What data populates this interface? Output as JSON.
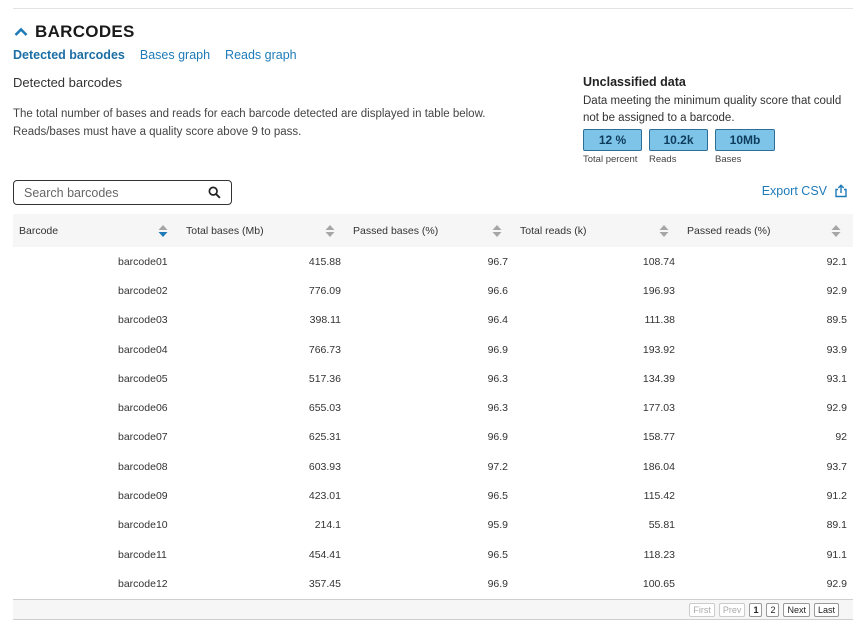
{
  "section": {
    "title": "BARCODES"
  },
  "tabs": [
    {
      "label": "Detected barcodes",
      "active": true
    },
    {
      "label": "Bases graph",
      "active": false
    },
    {
      "label": "Reads graph",
      "active": false
    }
  ],
  "main": {
    "subtitle": "Detected barcodes",
    "desc_line1": "The total number of bases and reads for each barcode detected are displayed in table below.",
    "desc_line2": "Reads/bases must have a quality score above 9 to pass."
  },
  "unclassified": {
    "title": "Unclassified data",
    "desc_line1": "Data meeting the minimum quality score that could",
    "desc_line2": "not be assigned to a barcode.",
    "stats": [
      {
        "value": "12 %",
        "label": "Total percent"
      },
      {
        "value": "10.2k",
        "label": "Reads"
      },
      {
        "value": "10Mb",
        "label": "Bases"
      }
    ]
  },
  "search": {
    "placeholder": "Search barcodes"
  },
  "export": {
    "label": "Export CSV"
  },
  "table": {
    "headers": [
      "Barcode",
      "Total bases (Mb)",
      "Passed bases (%)",
      "Total reads (k)",
      "Passed reads (%)"
    ],
    "sorted_column": 0,
    "sort_direction": "desc",
    "rows": [
      [
        "barcode01",
        "415.88",
        "96.7",
        "108.74",
        "92.1"
      ],
      [
        "barcode02",
        "776.09",
        "96.6",
        "196.93",
        "92.9"
      ],
      [
        "barcode03",
        "398.11",
        "96.4",
        "111.38",
        "89.5"
      ],
      [
        "barcode04",
        "766.73",
        "96.9",
        "193.92",
        "93.9"
      ],
      [
        "barcode05",
        "517.36",
        "96.3",
        "134.39",
        "93.1"
      ],
      [
        "barcode06",
        "655.03",
        "96.3",
        "177.03",
        "92.9"
      ],
      [
        "barcode07",
        "625.31",
        "96.9",
        "158.77",
        "92"
      ],
      [
        "barcode08",
        "603.93",
        "97.2",
        "186.04",
        "93.7"
      ],
      [
        "barcode09",
        "423.01",
        "96.5",
        "115.42",
        "91.2"
      ],
      [
        "barcode10",
        "214.1",
        "95.9",
        "55.81",
        "89.1"
      ],
      [
        "barcode11",
        "454.41",
        "96.5",
        "118.23",
        "91.1"
      ],
      [
        "barcode12",
        "357.45",
        "96.9",
        "100.65",
        "92.9"
      ]
    ]
  },
  "pager": {
    "first": "First",
    "prev": "Prev",
    "pages": [
      "1",
      "2"
    ],
    "current_page": "1",
    "next": "Next",
    "last": "Last"
  },
  "colors": {
    "accent": "#1f7bb8",
    "stat_fill": "#7ec3e8",
    "stat_border": "#2d6e97",
    "sort_active": "#1f7bb8",
    "sort_inactive": "#a6a6a6"
  }
}
